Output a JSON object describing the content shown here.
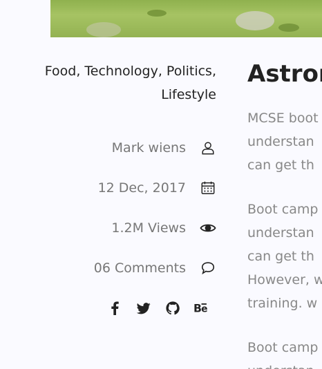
{
  "meta": {
    "categories": "Food, Technology, Politics, Lifestyle",
    "author": "Mark wiens",
    "date": "12 Dec, 2017",
    "views": "1.2M Views",
    "comments": "06 Comments"
  },
  "social": [
    "facebook-icon",
    "twitter-icon",
    "github-icon",
    "behance-icon"
  ],
  "article": {
    "title": "Astron",
    "para1": [
      "MCSE boot",
      "understan",
      "can get th"
    ],
    "para2": [
      "Boot camp",
      "understan",
      "can get th",
      "However, w",
      "training. w"
    ],
    "para3": [
      "Boot camp",
      "understan"
    ]
  }
}
